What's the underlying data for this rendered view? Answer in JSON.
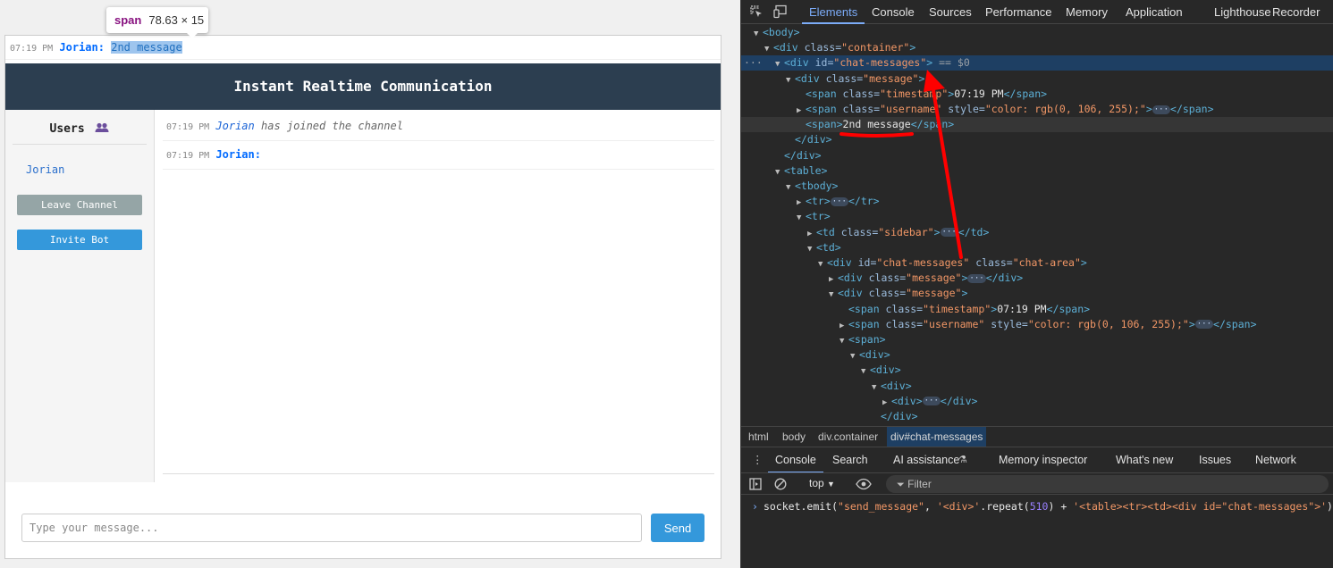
{
  "tooltip": {
    "tag": "span",
    "size": "78.63 × 15"
  },
  "top_message": {
    "time": "07:19 PM",
    "user": "Jorian:",
    "text": "2nd message"
  },
  "header": {
    "title": "Instant Realtime Communication"
  },
  "sidebar": {
    "users_title": "Users",
    "users_icon": "users-icon",
    "users": [
      "Jorian"
    ],
    "leave_label": "Leave Channel",
    "invite_label": "Invite Bot"
  },
  "chat": {
    "messages": [
      {
        "time": "07:19 PM",
        "user": "Jorian",
        "text": "has joined the channel"
      },
      {
        "time": "07:19 PM",
        "user": "Jorian:",
        "text": ""
      }
    ]
  },
  "input": {
    "placeholder": "Type your message...",
    "send_label": "Send"
  },
  "devtools": {
    "tabs": [
      "Elements",
      "Console",
      "Sources",
      "Performance",
      "Memory",
      "Application",
      "Lighthouse",
      "Recorder"
    ],
    "tree": [
      {
        "open": "<body>"
      },
      {
        "open": "<div",
        "attrs": [
          [
            "class",
            "container"
          ]
        ],
        "close": ">"
      },
      {
        "open": "<div",
        "attrs": [
          [
            "id",
            "chat-messages"
          ]
        ],
        "close": ">",
        "extra": "== $0"
      },
      {
        "open": "<div",
        "attrs": [
          [
            "class",
            "message"
          ]
        ],
        "close": ">"
      },
      {
        "open": "<span",
        "attrs": [
          [
            "class",
            "timestamp"
          ]
        ],
        "close": ">",
        "text": "07:19 PM",
        "end": "</span>"
      },
      {
        "open": "<span",
        "attrs": [
          [
            "class",
            "username"
          ],
          [
            "style",
            "color: rgb(0, 106, 255);"
          ]
        ],
        "close": ">",
        "end": "</span>"
      },
      {
        "open": "<span>",
        "text": "2nd message",
        "end": "</span>"
      },
      {
        "open": "</div>"
      },
      {
        "open": "</div>"
      },
      {
        "open": "<table>"
      },
      {
        "open": "<tbody>"
      },
      {
        "open": "<tr>",
        "end": "</tr>"
      },
      {
        "open": "<tr>"
      },
      {
        "open": "<td",
        "attrs": [
          [
            "class",
            "sidebar"
          ]
        ],
        "close": ">",
        "end": "</td>"
      },
      {
        "open": "<td>"
      },
      {
        "open": "<div",
        "attrs": [
          [
            "id",
            "chat-messages"
          ],
          [
            "class",
            "chat-area"
          ]
        ],
        "close": ">"
      },
      {
        "open": "<div",
        "attrs": [
          [
            "class",
            "message"
          ]
        ],
        "close": ">",
        "end": "</div>"
      },
      {
        "open": "<div",
        "attrs": [
          [
            "class",
            "message"
          ]
        ],
        "close": ">"
      },
      {
        "open": "<span",
        "attrs": [
          [
            "class",
            "timestamp"
          ]
        ],
        "close": ">",
        "text": "07:19 PM",
        "end": "</span>"
      },
      {
        "open": "<span",
        "attrs": [
          [
            "class",
            "username"
          ],
          [
            "style",
            "color: rgb(0, 106, 255);"
          ]
        ],
        "close": ">",
        "end": "</span>"
      },
      {
        "open": "<span>"
      },
      {
        "open": "<div>"
      },
      {
        "open": "<div>"
      },
      {
        "open": "<div>"
      },
      {
        "open": "<div>",
        "end": "</div>"
      },
      {
        "open": "</div>"
      }
    ],
    "breadcrumb": [
      "html",
      "body",
      "div.container",
      "div#chat-messages"
    ],
    "drawer_tabs": [
      "Console",
      "Search",
      "AI assistance",
      "Memory inspector",
      "What's new",
      "Issues",
      "Network"
    ],
    "console_context": "top",
    "filter_placeholder": "Filter",
    "console_command": {
      "prefix": "socket.",
      "fn": "emit(",
      "arg1": "\"send_message\"",
      "sep1": ", ",
      "arg2": "'<div>'",
      "method": ".repeat(",
      "num": "510",
      "close1": ") + ",
      "arg3": "'<table><tr><td><div id=\"chat-messages\">'",
      "close2": ")"
    }
  }
}
